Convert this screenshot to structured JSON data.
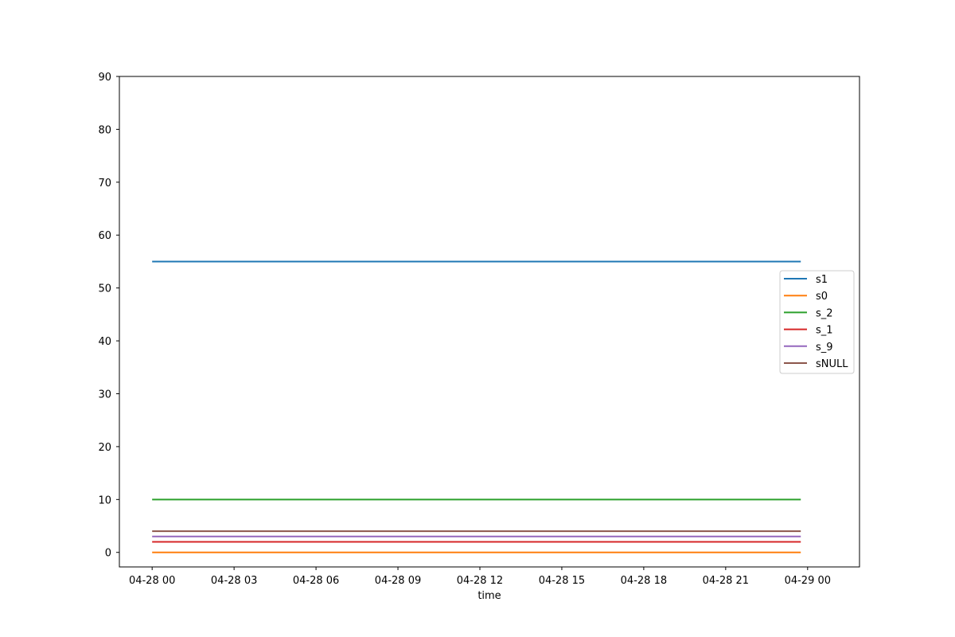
{
  "chart_data": {
    "type": "line",
    "title": "",
    "xlabel": "time",
    "ylabel": "",
    "x_ticks": [
      "04-28 00",
      "04-28 03",
      "04-28 06",
      "04-28 09",
      "04-28 12",
      "04-28 15",
      "04-28 18",
      "04-28 21",
      "04-29 00"
    ],
    "x_range_hours": [
      -1.2,
      25.9
    ],
    "x_start": "04-28 00",
    "x_end": "04-28 23:45",
    "ylim": [
      -2.75,
      90
    ],
    "y_ticks": [
      0,
      10,
      20,
      30,
      40,
      50,
      60,
      70,
      80,
      90
    ],
    "grid": false,
    "legend_position": "center-right",
    "series": [
      {
        "name": "s1",
        "color": "#1f77b4",
        "values": [
          55,
          55
        ]
      },
      {
        "name": "s0",
        "color": "#ff7f0e",
        "values": [
          0,
          0
        ]
      },
      {
        "name": "s_2",
        "color": "#2ca02c",
        "values": [
          10,
          10
        ]
      },
      {
        "name": "s_1",
        "color": "#d62728",
        "values": [
          2,
          2
        ]
      },
      {
        "name": "s_9",
        "color": "#9467bd",
        "values": [
          3,
          3
        ]
      },
      {
        "name": "sNULL",
        "color": "#8c564b",
        "values": [
          4,
          4
        ]
      }
    ]
  }
}
